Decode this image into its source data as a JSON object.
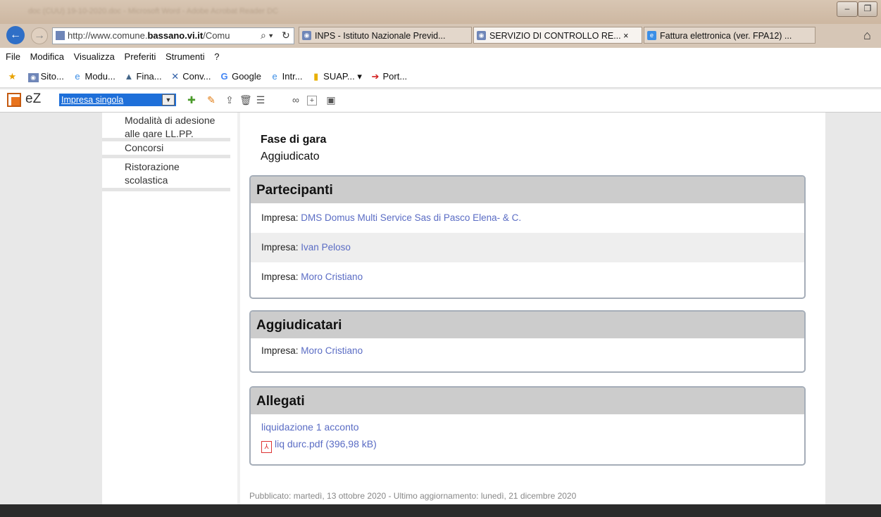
{
  "browser": {
    "address": {
      "prefix": "http://www.comune.",
      "domain": "bassano.vi.it",
      "suffix": "/Comu"
    },
    "tabs": [
      {
        "label": "INPS - Istituto Nazionale Previd...",
        "active": false
      },
      {
        "label": "SERVIZIO DI CONTROLLO RE...",
        "active": true,
        "close": "×"
      },
      {
        "label": "Fattura elettronica (ver. FPA12) ...",
        "active": false
      }
    ],
    "menu": [
      "File",
      "Modifica",
      "Visualizza",
      "Preferiti",
      "Strumenti",
      "?"
    ],
    "favorites": [
      "Sito...",
      "Modu...",
      "Fina...",
      "Conv...",
      "Google",
      "Intr...",
      "SUAP...",
      "Port..."
    ],
    "title_blurred": "doc (CUU) 19-10-2020.doc - Microsoft Word - Adobe Acrobat Reader DC"
  },
  "ez_toolbar": {
    "logo_text": "eZ",
    "select_value": "Impresa singola"
  },
  "sidebar": {
    "items": [
      "Modalità di adesione alle gare LL.PP.",
      "Concorsi",
      "Ristorazione scolastica"
    ]
  },
  "content": {
    "phase_label": "Fase di gara",
    "phase_value": "Aggiudicato",
    "participants": {
      "title": "Partecipanti",
      "items": [
        {
          "label": "Impresa:",
          "value": "DMS Domus Multi Service Sas di Pasco Elena- & C."
        },
        {
          "label": "Impresa:",
          "value": "Ivan Peloso"
        },
        {
          "label": "Impresa:",
          "value": "Moro Cristiano"
        }
      ]
    },
    "awardees": {
      "title": "Aggiudicatari",
      "items": [
        {
          "label": "Impresa:",
          "value": "Moro Cristiano"
        }
      ]
    },
    "attachments": {
      "title": "Allegati",
      "group": "liquidazione 1 acconto",
      "file": "liq durc.pdf (396,98 kB)"
    },
    "published": "Pubblicato: martedì, 13 ottobre 2020 - Ultimo aggiornamento: lunedì, 21 dicembre 2020"
  }
}
